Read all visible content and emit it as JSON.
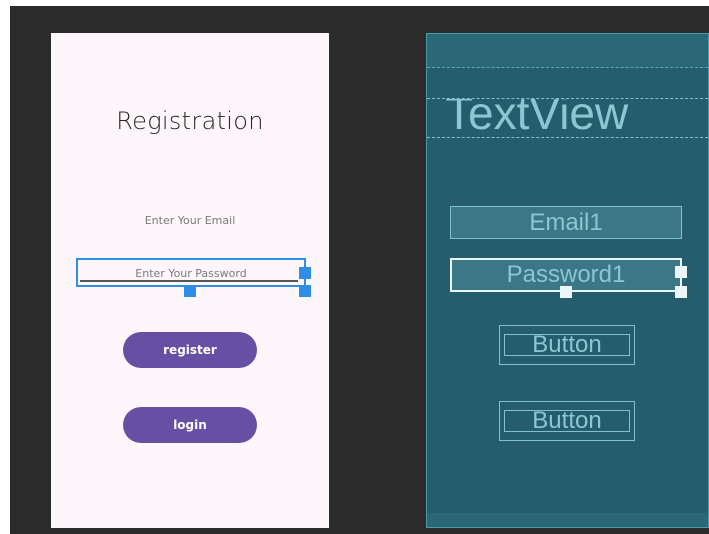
{
  "design": {
    "title": "Registration",
    "email_hint": "Enter Your Email",
    "password_hint": "Enter Your Password",
    "register_label": "register",
    "login_label": "login"
  },
  "blueprint": {
    "textview_label": "TextView",
    "email_label": "Email1",
    "password_label": "Password1",
    "button1_label": "Button",
    "button2_label": "Button"
  },
  "colors": {
    "editor_background": "#2b2b2b",
    "design_background": "#fdf6fb",
    "button_purple": "#6750a4",
    "selection_blue": "#2d8de8",
    "blueprint_background": "#255d6c"
  }
}
